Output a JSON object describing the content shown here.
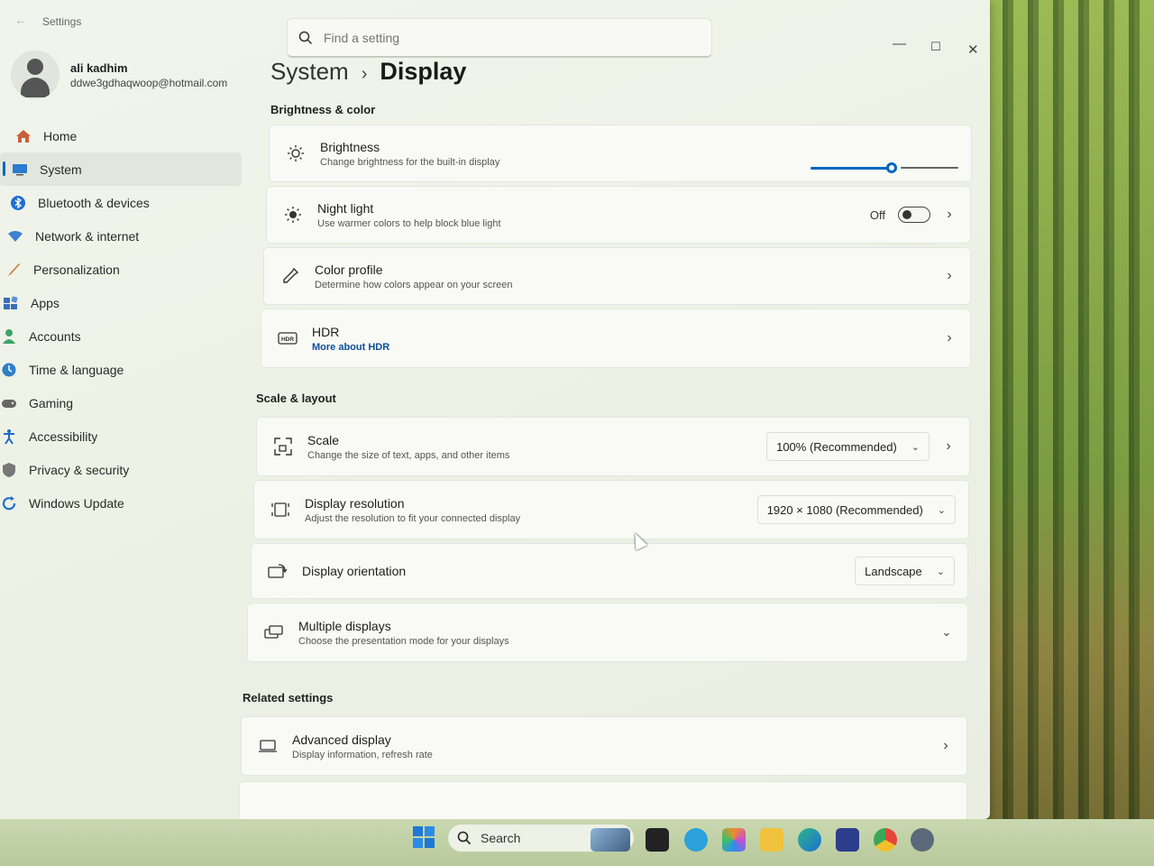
{
  "window": {
    "title": "Settings"
  },
  "search": {
    "placeholder": "Find a setting"
  },
  "user": {
    "name": "ali kadhim",
    "email": "ddwe3gdhaqwoop@hotmail.com"
  },
  "sidebar": {
    "items": [
      {
        "label": "Home",
        "icon": "home-icon"
      },
      {
        "label": "System",
        "icon": "system-icon",
        "active": true
      },
      {
        "label": "Bluetooth & devices",
        "icon": "bluetooth-icon"
      },
      {
        "label": "Network & internet",
        "icon": "network-icon"
      },
      {
        "label": "Personalization",
        "icon": "brush-icon"
      },
      {
        "label": "Apps",
        "icon": "apps-icon"
      },
      {
        "label": "Accounts",
        "icon": "accounts-icon"
      },
      {
        "label": "Time & language",
        "icon": "globe-clock-icon"
      },
      {
        "label": "Gaming",
        "icon": "gamepad-icon"
      },
      {
        "label": "Accessibility",
        "icon": "accessibility-icon"
      },
      {
        "label": "Privacy & security",
        "icon": "shield-icon"
      },
      {
        "label": "Windows Update",
        "icon": "update-icon"
      }
    ]
  },
  "breadcrumb": {
    "parent": "System",
    "separator": "›",
    "current": "Display"
  },
  "sections": {
    "brightness_color": "Brightness & color",
    "scale_layout": "Scale & layout",
    "related": "Related settings"
  },
  "brightness": {
    "title": "Brightness",
    "subtitle": "Change brightness for the built-in display",
    "level_percent": 55
  },
  "night_light": {
    "title": "Night light",
    "subtitle": "Use warmer colors to help block blue light",
    "state": "Off"
  },
  "color_profile": {
    "title": "Color profile",
    "subtitle": "Determine how colors appear on your screen"
  },
  "hdr": {
    "title": "HDR",
    "link": "More about HDR"
  },
  "scale": {
    "title": "Scale",
    "subtitle": "Change the size of text, apps, and other items",
    "value": "100% (Recommended)"
  },
  "resolution": {
    "title": "Display resolution",
    "subtitle": "Adjust the resolution to fit your connected display",
    "value": "1920 × 1080 (Recommended)"
  },
  "orientation": {
    "title": "Display orientation",
    "value": "Landscape"
  },
  "multiple_displays": {
    "title": "Multiple displays",
    "subtitle": "Choose the presentation mode for your displays"
  },
  "advanced_display": {
    "title": "Advanced display",
    "subtitle": "Display information, refresh rate"
  },
  "taskbar": {
    "search_label": "Search"
  },
  "colors": {
    "accent": "#0067c0",
    "link": "#0b4f9a"
  }
}
